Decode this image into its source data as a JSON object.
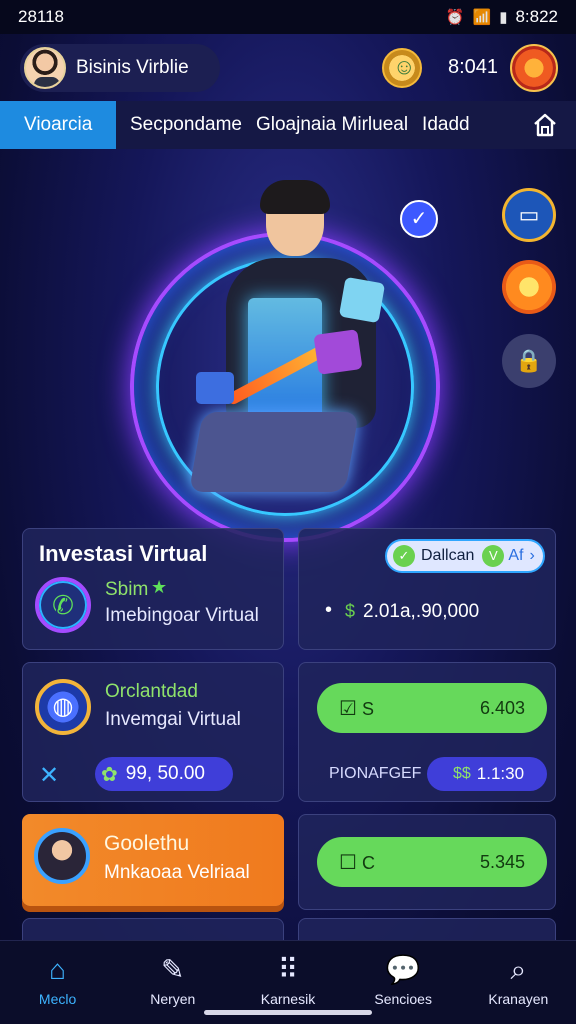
{
  "status_bar": {
    "time": "28118",
    "right_time": "8:822"
  },
  "header": {
    "user_name": "Bisinis Virblie",
    "coins": "8:041"
  },
  "tabs": {
    "active": "Vioarcia",
    "items": [
      "Secpondame",
      "Gloajnaia Mirlueal",
      "Idadd"
    ]
  },
  "cards": {
    "investasi": {
      "title": "Investasi Virtual",
      "label": "Sbim",
      "sub": "Imebingoar Virtual"
    },
    "balance_card": {
      "pill_label": "Dallcan",
      "pill_tag": "Af",
      "amount": "2.01a,.90,000"
    },
    "orclandad": {
      "title": "Orclantdad",
      "sub": "Invemgai Virtual",
      "amount": "99, 50.00"
    },
    "green_1": {
      "left": "S",
      "right": "6.403"
    },
    "manager": {
      "label": "PIONAFGEF",
      "value": "1.1:30"
    },
    "goolethu": {
      "title": "Goolethu",
      "sub": "Mnkaoaa Velriaal"
    },
    "green_2": {
      "left": "C",
      "right": "5.345"
    }
  },
  "bottom_nav": [
    {
      "label": "Meclo",
      "icon": "home-icon"
    },
    {
      "label": "Neryen",
      "icon": "edit-icon"
    },
    {
      "label": "Karnesik",
      "icon": "grid-icon"
    },
    {
      "label": "Sencioes",
      "icon": "chat-icon"
    },
    {
      "label": "Kranayen",
      "icon": "search-icon"
    }
  ],
  "colors": {
    "accent": "#1e8be0",
    "green": "#66d95b",
    "orange": "#f28a2a",
    "purple": "#3f3ed9"
  }
}
